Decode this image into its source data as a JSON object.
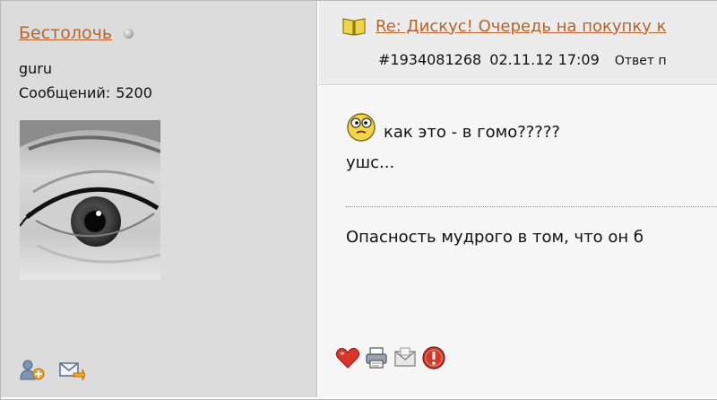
{
  "user": {
    "name": "Бестолочь",
    "rank": "guru",
    "posts_label": "Сообщений:",
    "posts_count": "5200",
    "status_icon": "offline-dot-icon",
    "actions": [
      "add-friend-icon",
      "send-message-icon"
    ]
  },
  "post": {
    "title": "Re: Дискус! Очередь на покупку к",
    "id": "#1934081268",
    "date": "02.11.12 17:09",
    "reply_label": "Ответ п",
    "line1": "как это - в гомо?????",
    "line2": "ушс...",
    "signature": "Опасность мудрого в том, что он б",
    "title_icon": "book-icon",
    "smiley_icon": "surprised-smiley-icon",
    "actions": [
      "like-heart-icon",
      "print-icon",
      "mail-icon",
      "report-icon"
    ]
  },
  "colors": {
    "link": "#b8642a",
    "left_panel_bg": "#dcdcdc",
    "header_bg": "#ececec",
    "body_bg": "#f6f6f6"
  }
}
